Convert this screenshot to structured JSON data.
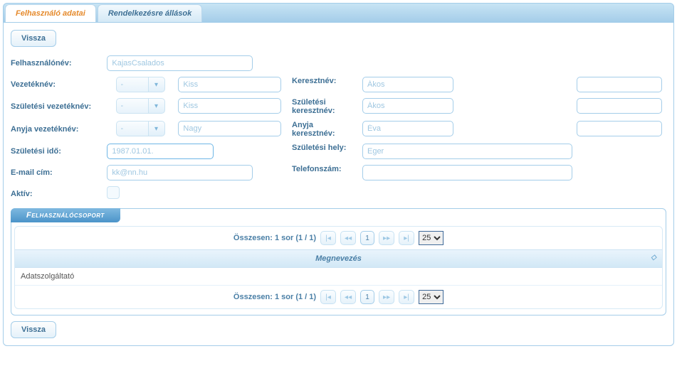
{
  "tabs": {
    "active": "Felhasználó adatai",
    "other": "Rendelkezésre állások"
  },
  "buttons": {
    "back": "Vissza"
  },
  "form": {
    "labels": {
      "username": "Felhasználónév:",
      "surname": "Vezetéknév:",
      "givenname": "Keresztnév:",
      "birth_surname": "Születési vezetéknév:",
      "birth_givenname": "Születési keresztnév:",
      "mother_surname": "Anyja vezetéknév:",
      "mother_givenname": "Anyja keresztnév:",
      "birth_date": "Születési idő:",
      "birth_place": "Születési hely:",
      "email": "E-mail cím:",
      "phone": "Telefonszám:",
      "active": "Aktív:"
    },
    "values": {
      "username": "KajasCsalados",
      "prefix1": "-",
      "surname": "Kiss",
      "givenname": "Ákos",
      "suffix1": "",
      "prefix2": "-",
      "birth_surname": "Kiss",
      "birth_givenname": "Ákos",
      "suffix2": "",
      "prefix3": "-",
      "mother_surname": "Nagy",
      "mother_givenname": "Éva",
      "suffix3": "",
      "birth_date": "1987.01.01.",
      "birth_place": "Eger",
      "email": "kk@nn.hu",
      "phone": ""
    }
  },
  "section": {
    "title": "Felhasználócsoport",
    "paginator": {
      "label": "Összesen: 1 sor (1 / 1)",
      "page": "1",
      "page_size": "25"
    },
    "header": "Megnevezés",
    "rows": [
      "Adatszolgáltató"
    ]
  }
}
